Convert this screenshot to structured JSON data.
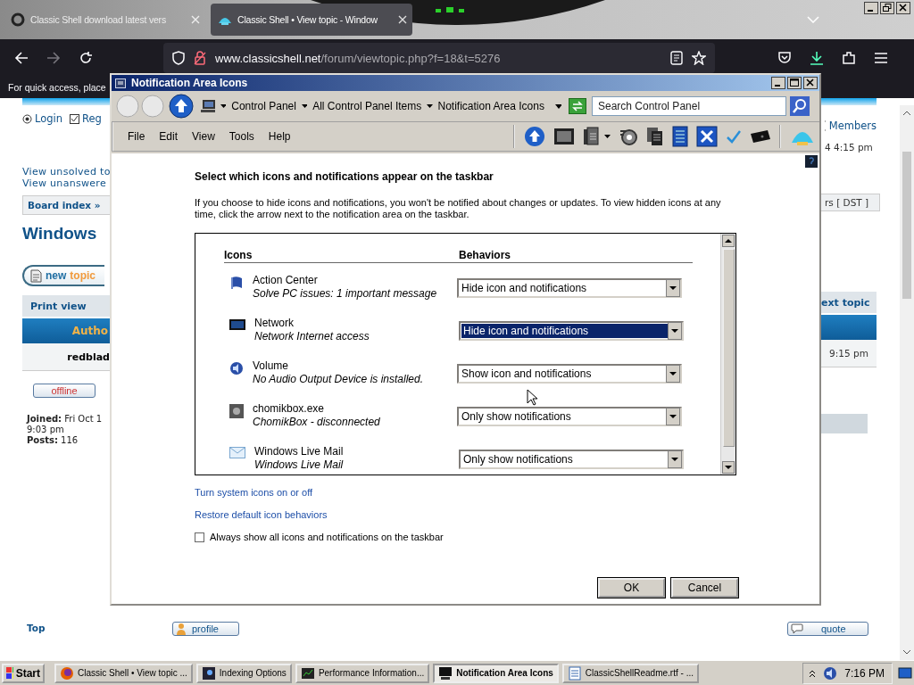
{
  "browser": {
    "tabs": [
      {
        "title": "Classic Shell download latest vers",
        "selected": false
      },
      {
        "title": "Classic Shell • View topic - Window",
        "selected": true
      }
    ],
    "url_host": "www.classicshell.net",
    "url_path": "/forum/viewtopic.php?f=18&t=5276",
    "bookmarks_hint": "For quick access, place"
  },
  "forum": {
    "login": "Login",
    "register": "Reg",
    "members": "Members",
    "last_visit": "4 4:15 pm",
    "view_links": [
      "View unsolved to",
      "View unanswere"
    ],
    "breadcrumb": "Board index »",
    "timezone": "rs [ DST ]",
    "topic_title": "Windows",
    "new_topic": {
      "new": "new",
      "topic": "topic"
    },
    "print_view": "Print view",
    "next_topic": "ext topic",
    "author_header": "Autho",
    "author": "redblad",
    "post_time": "9:15 pm",
    "status": "offline",
    "profile_lines": [
      "**Joined:** Fri Oct 1",
      "9:03 pm",
      "**Posts:** 116"
    ],
    "top_link": "Top",
    "profile": "profile",
    "quote": "quote"
  },
  "dialog": {
    "title": "Notification Area Icons",
    "breadcrumb": [
      "Control Panel",
      "All Control Panel Items",
      "Notification Area Icons"
    ],
    "search": {
      "placeholder": "Search Control Panel"
    },
    "menu": [
      "File",
      "Edit",
      "View",
      "Tools",
      "Help"
    ],
    "heading": "Select which icons and notifications appear on the taskbar",
    "description": "If you choose to hide icons and notifications, you won't be notified about changes or updates. To view hidden icons at any time, click the arrow next to the notification area on the taskbar.",
    "columns": [
      "Icons",
      "Behaviors"
    ],
    "rows": [
      {
        "name": "Action Center",
        "description": "Solve PC issues: 1 important message",
        "behavior": "Hide icon and notifications",
        "focused": false
      },
      {
        "name": "Network",
        "description": "Network Internet access",
        "behavior": "Hide icon and notifications",
        "focused": true
      },
      {
        "name": "Volume",
        "description": "No Audio Output Device is installed.",
        "behavior": "Show icon and notifications",
        "focused": false
      },
      {
        "name": "chomikbox.exe",
        "description": "ChomikBox - disconnected",
        "behavior": "Only show notifications",
        "focused": false
      },
      {
        "name": "Windows Live Mail",
        "description": "Windows Live Mail",
        "behavior": "Only show notifications",
        "focused": false
      }
    ],
    "links": [
      "Turn system icons on or off",
      "Restore default icon behaviors"
    ],
    "checkbox": {
      "label": "Always show all icons and notifications on the taskbar",
      "checked": false
    },
    "buttons": [
      "OK",
      "Cancel"
    ]
  },
  "taskbar": {
    "start": "Start",
    "tasks": [
      {
        "label": "Classic Shell • View topic ...",
        "selected": false
      },
      {
        "label": "Indexing Options",
        "selected": false
      },
      {
        "label": "Performance Information...",
        "selected": false
      },
      {
        "label": "Notification Area Icons",
        "selected": true
      },
      {
        "label": "ClassicShellReadme.rtf - ...",
        "selected": false
      }
    ],
    "clock": "7:16 PM"
  }
}
